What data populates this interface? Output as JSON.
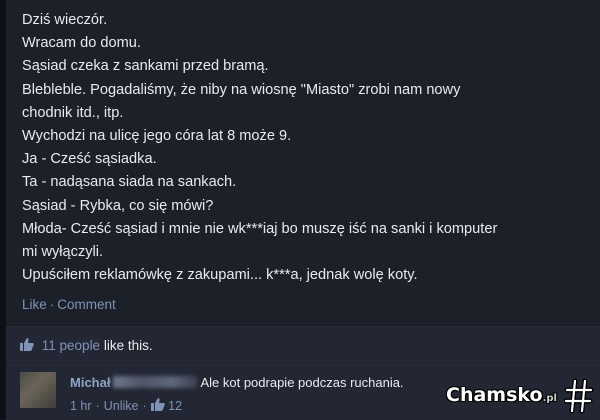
{
  "post": {
    "lines": [
      "Dziś wieczór.",
      "Wracam do domu.",
      "Sąsiad czeka z sankami przed bramą.",
      "Blebleble. Pogadaliśmy, że niby na wiosnę \"Miasto\" zrobi nam nowy",
      "chodnik itd., itp.",
      "Wychodzi na ulicę jego córa lat 8 może 9.",
      "Ja - Cześć sąsiadka.",
      "Ta - nadąsana siada na sankach.",
      "Sąsiad - Rybka, co się mówi?",
      "Młoda- Cześć sąsiad i mnie nie wk***iaj bo muszę iść na sanki i komputer",
      "mi wyłączyli.",
      "Upuściłem reklamówkę z zakupami... k***a, jednak wolę koty."
    ],
    "actions": {
      "like": "Like",
      "separator": "·",
      "comment": "Comment"
    }
  },
  "likes": {
    "count_text": "11 people",
    "suffix": "like this."
  },
  "comment": {
    "author": "Michał",
    "text": "Ale kot podrapie podczas ruchania.",
    "time": "1 hr",
    "separator": "·",
    "unlike": "Unlike",
    "like_count": "12"
  },
  "watermark": {
    "brand": "Chamsko",
    "tld": ".pl"
  },
  "colors": {
    "background": "#1c2029",
    "text": "#e9ebee",
    "link": "#7f93b8"
  }
}
